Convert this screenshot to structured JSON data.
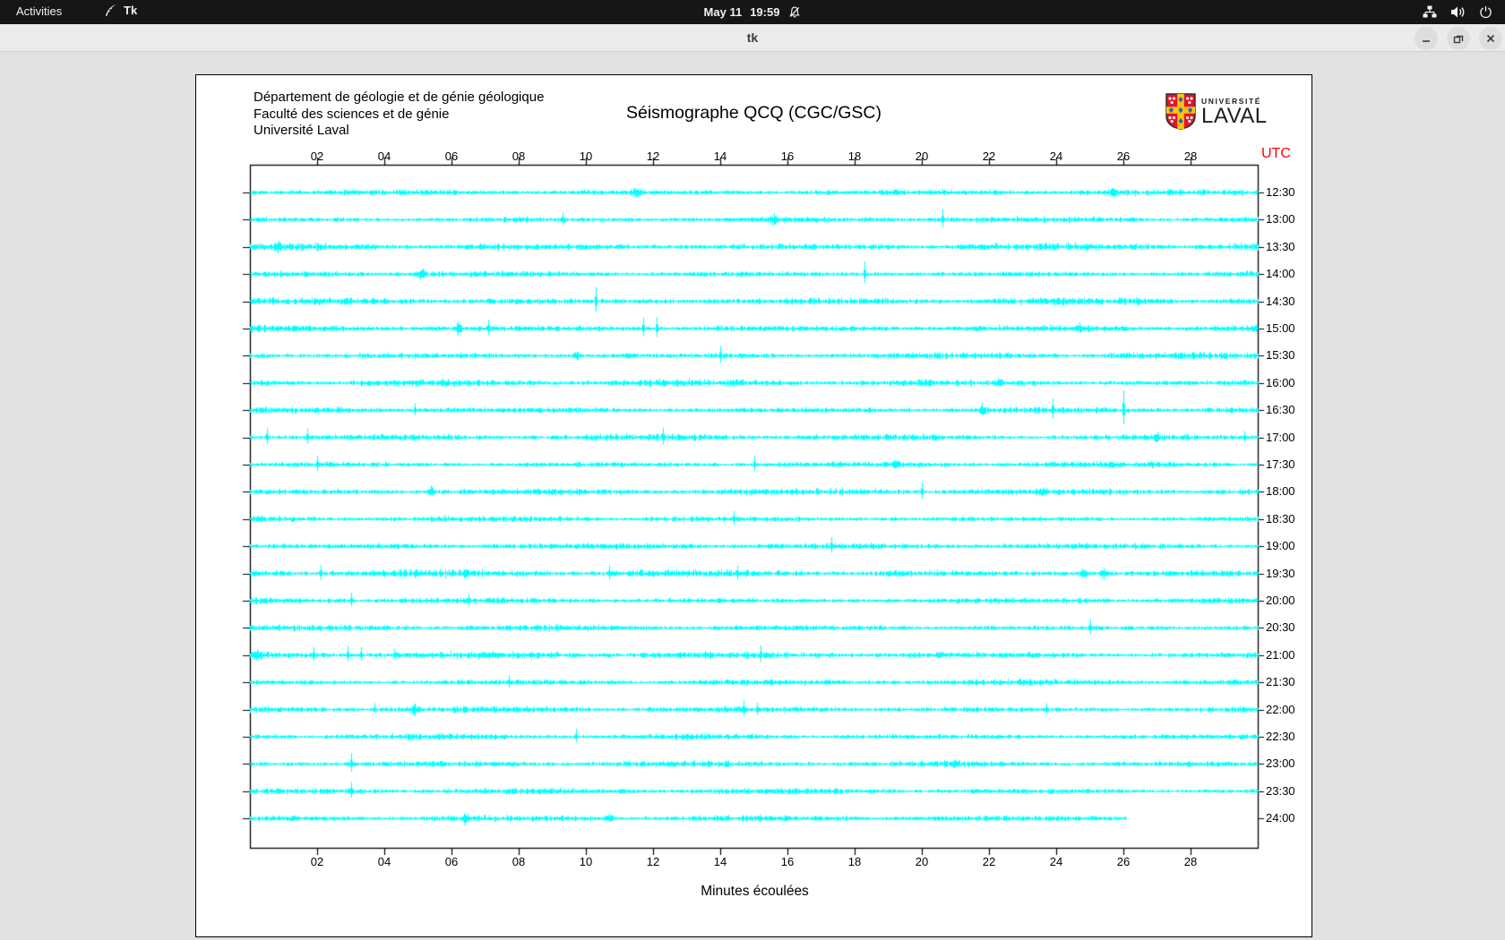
{
  "top_bar": {
    "activities": "Activities",
    "app_name": "Tk",
    "clock_date": "May 11",
    "clock_time": "19:59"
  },
  "window": {
    "title": "tk"
  },
  "header": {
    "line1": "Département de géologie et de génie géologique",
    "line2": "Faculté des sciences et de génie",
    "line3": "Université Laval"
  },
  "logo": {
    "line1": "UNIVERSITÉ",
    "line2": "LAVAL"
  },
  "colors": {
    "trace_cyan": "#00ffff",
    "utc_red": "#ff0000",
    "logo_red": "#e8112d",
    "logo_gold": "#ffc20e",
    "logo_blue": "#1e6bb8",
    "axis_black": "#000000"
  },
  "chart_data": {
    "type": "line",
    "variant": "seismogram-helicorder",
    "title": "Séismographe QCQ (CGC/GSC)",
    "xlabel": "Minutes écoulées",
    "right_axis_label": "UTC",
    "x_range_minutes": [
      0,
      30
    ],
    "x_tick_minutes": [
      2,
      4,
      6,
      8,
      10,
      12,
      14,
      16,
      18,
      20,
      22,
      24,
      26,
      28
    ],
    "x_ticks": [
      "02",
      "04",
      "06",
      "08",
      "10",
      "12",
      "14",
      "16",
      "18",
      "20",
      "22",
      "24",
      "26",
      "28"
    ],
    "grid": false,
    "rows": [
      {
        "label": "12:30",
        "noise": 1.4,
        "spikes": [
          [
            11.5,
            4
          ],
          [
            25.7,
            3
          ]
        ]
      },
      {
        "label": "13:00",
        "noise": 1.3,
        "spikes": [
          [
            9.3,
            8
          ],
          [
            15.6,
            5
          ],
          [
            20.6,
            12
          ]
        ]
      },
      {
        "label": "13:30",
        "noise": 1.6,
        "spikes": [
          [
            0.8,
            5
          ]
        ]
      },
      {
        "label": "14:00",
        "noise": 1.3,
        "spikes": [
          [
            5.1,
            6
          ],
          [
            18.3,
            14
          ]
        ]
      },
      {
        "label": "14:30",
        "noise": 1.6,
        "spikes": [
          [
            10.3,
            16
          ]
        ]
      },
      {
        "label": "15:00",
        "noise": 1.5,
        "spikes": [
          [
            6.2,
            5
          ],
          [
            7.1,
            10
          ],
          [
            11.7,
            12
          ],
          [
            12.1,
            13
          ],
          [
            24.7,
            7
          ]
        ]
      },
      {
        "label": "15:30",
        "noise": 1.4,
        "spikes": [
          [
            9.7,
            6
          ],
          [
            14.0,
            11
          ]
        ]
      },
      {
        "label": "16:00",
        "noise": 1.5,
        "spikes": [
          [
            22.3,
            4
          ]
        ]
      },
      {
        "label": "16:30",
        "noise": 1.4,
        "spikes": [
          [
            4.9,
            8
          ],
          [
            21.8,
            6
          ],
          [
            23.9,
            13
          ],
          [
            26.0,
            22
          ]
        ]
      },
      {
        "label": "17:00",
        "noise": 1.4,
        "spikes": [
          [
            0.5,
            10
          ],
          [
            1.7,
            10
          ],
          [
            12.3,
            11
          ],
          [
            27.0,
            5
          ],
          [
            29.6,
            7
          ]
        ]
      },
      {
        "label": "17:30",
        "noise": 1.3,
        "spikes": [
          [
            2.0,
            10
          ],
          [
            15.0,
            10
          ],
          [
            19.2,
            4
          ]
        ]
      },
      {
        "label": "18:00",
        "noise": 1.4,
        "spikes": [
          [
            5.4,
            5
          ],
          [
            20.0,
            11
          ]
        ]
      },
      {
        "label": "18:30",
        "noise": 1.3,
        "spikes": [
          [
            14.4,
            9
          ]
        ]
      },
      {
        "label": "19:00",
        "noise": 1.3,
        "spikes": [
          [
            17.3,
            10
          ]
        ]
      },
      {
        "label": "19:30",
        "noise": 1.6,
        "spikes": [
          [
            2.1,
            10
          ],
          [
            10.7,
            9
          ],
          [
            14.5,
            9
          ],
          [
            24.8,
            5
          ],
          [
            25.4,
            5
          ]
        ]
      },
      {
        "label": "20:00",
        "noise": 1.4,
        "spikes": [
          [
            3.0,
            9
          ],
          [
            6.5,
            8
          ]
        ]
      },
      {
        "label": "20:30",
        "noise": 1.3,
        "spikes": [
          [
            25.0,
            10
          ]
        ]
      },
      {
        "label": "21:00",
        "noise": 1.5,
        "spikes": [
          [
            0.2,
            5
          ],
          [
            1.9,
            9
          ],
          [
            2.9,
            10
          ],
          [
            3.3,
            9
          ],
          [
            4.3,
            7
          ],
          [
            15.2,
            11
          ]
        ]
      },
      {
        "label": "21:30",
        "noise": 1.3,
        "spikes": [
          [
            7.7,
            8
          ]
        ]
      },
      {
        "label": "22:00",
        "noise": 1.4,
        "spikes": [
          [
            3.7,
            7
          ],
          [
            4.9,
            4
          ],
          [
            14.7,
            10
          ],
          [
            15.1,
            8
          ],
          [
            23.7,
            7
          ]
        ]
      },
      {
        "label": "22:30",
        "noise": 1.3,
        "spikes": [
          [
            9.7,
            9
          ]
        ]
      },
      {
        "label": "23:00",
        "noise": 1.3,
        "spikes": [
          [
            3.0,
            12
          ],
          [
            21.0,
            4
          ]
        ]
      },
      {
        "label": "23:30",
        "noise": 1.3,
        "spikes": [
          [
            3.0,
            10
          ]
        ]
      },
      {
        "label": "24:00",
        "noise": 1.3,
        "spikes": [
          [
            6.4,
            4
          ],
          [
            10.7,
            5
          ]
        ],
        "end_minute": 26.1
      }
    ]
  }
}
